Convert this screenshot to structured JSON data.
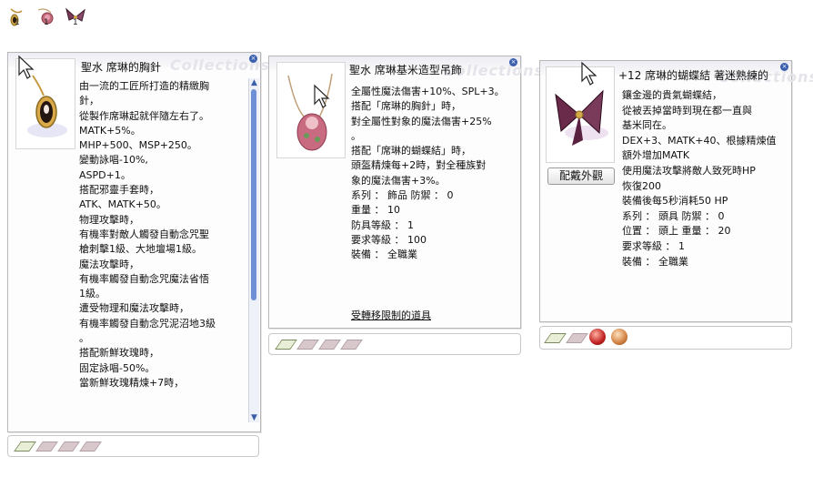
{
  "top_icons": [
    {
      "name": "pendant-icon",
      "count": "1"
    },
    {
      "name": "pendant-icon",
      "count": "1"
    },
    {
      "name": "butterfly-icon",
      "count": "1"
    }
  ],
  "panel1": {
    "title": "聖水 席琳的胸針",
    "watermark": "Collections",
    "close": "×",
    "desc": [
      "由一流的工匠所打造的精緻胸",
      "針，",
      "從製作席琳起就伴隨左右了。",
      "MATK+5%。",
      "MHP+500、MSP+250。",
      "變動詠唱-10%,",
      "ASPD+1。",
      "搭配邪靈手套時，",
      "ATK、MATK+50。",
      "物理攻擊時，",
      "有機率對敵人觸發自動念咒聖",
      "槍刺擊1級、大地壇場1級。",
      "魔法攻擊時，",
      "有機率觸發自動念咒魔法省悟",
      "1級。",
      "遭受物理和魔法攻擊時，",
      "有機率觸發自動念咒泥沼地3級",
      "。",
      "搭配新鮮玫瑰時，",
      "固定詠唱-50%。",
      "當新鮮玫瑰精煉+7時，"
    ]
  },
  "panel2": {
    "title": "聖水 席琳基米造型吊飾",
    "watermark": "Collections",
    "close": "×",
    "desc": [
      "全屬性魔法傷害+10%、SPL+3。",
      "搭配「席琳的胸針」時，",
      "對全屬性對象的魔法傷害+25%",
      "。",
      "搭配「席琳的蝴蝶結」時，",
      "頭盔精煉每+2時，對全種族對",
      "象的魔法傷害+3%。",
      "系列 ： 飾品  防禦 ： 0",
      "重量 ： 10",
      "防具等級 ： 1",
      "要求等級 ： 100",
      "裝備 ： 全職業"
    ],
    "link": "受轉移限制的道具"
  },
  "panel3": {
    "title": "+12 席琳的蝴蝶結 著迷熟練的",
    "watermark": "Collections",
    "close": "×",
    "button": "配戴外觀",
    "desc": [
      "鑲金邊的貴氣蝴蝶結，",
      "從被丟掉當時到現在都一直與",
      "基米同在。",
      "DEX+3、MATK+40、根據精煉值",
      "額外增加MATK",
      "使用魔法攻擊將敵人致死時HP",
      "恢復200",
      "裝備後每5秒消耗50 HP",
      "系列 ： 頭具  防禦 ： 0",
      "位置 ： 頭上  重量 ： 20",
      "要求等級 ： 1",
      "裝備 ： 全職業"
    ]
  }
}
